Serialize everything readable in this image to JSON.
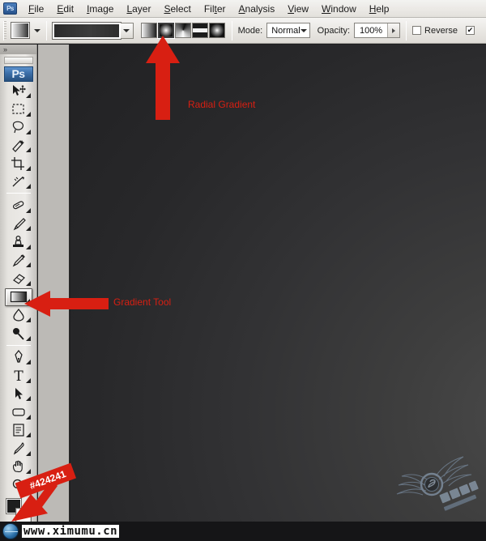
{
  "app": {
    "name": "Adobe Photoshop",
    "logo_text": "Ps"
  },
  "menubar": {
    "items": [
      {
        "label": "File",
        "accel": "F"
      },
      {
        "label": "Edit",
        "accel": "E"
      },
      {
        "label": "Image",
        "accel": "I"
      },
      {
        "label": "Layer",
        "accel": "L"
      },
      {
        "label": "Select",
        "accel": "S"
      },
      {
        "label": "Filter",
        "accel": "t"
      },
      {
        "label": "Analysis",
        "accel": "A"
      },
      {
        "label": "View",
        "accel": "V"
      },
      {
        "label": "Window",
        "accel": "W"
      },
      {
        "label": "Help",
        "accel": "H"
      }
    ]
  },
  "options_bar": {
    "tool_preset_icon": "gradient-preset-icon",
    "gradient_picker_icon": "gradient-preview-swatch",
    "gradient_dropdown_icon": "chevron-down-icon",
    "gradient_types": [
      {
        "name": "linear-gradient",
        "label": "Linear Gradient",
        "selected": false
      },
      {
        "name": "radial-gradient",
        "label": "Radial Gradient",
        "selected": true
      },
      {
        "name": "angle-gradient",
        "label": "Angle Gradient",
        "selected": false
      },
      {
        "name": "reflected-gradient",
        "label": "Reflected Gradient",
        "selected": false
      },
      {
        "name": "diamond-gradient",
        "label": "Diamond Gradient",
        "selected": false
      }
    ],
    "mode_label": "Mode:",
    "mode_value": "Normal",
    "opacity_label": "Opacity:",
    "opacity_value": "100%",
    "reverse_label": "Reverse",
    "reverse_checked": false,
    "dither_checked": true
  },
  "toolbar": {
    "collapse_icon": "double-chevron-right-icon",
    "tools": [
      {
        "name": "move-tool",
        "label": "Move Tool"
      },
      {
        "name": "marquee-tool",
        "label": "Rectangular Marquee Tool"
      },
      {
        "name": "lasso-tool",
        "label": "Lasso Tool"
      },
      {
        "name": "quick-selection-tool",
        "label": "Quick Selection Tool"
      },
      {
        "name": "crop-tool",
        "label": "Crop Tool"
      },
      {
        "name": "slice-tool",
        "label": "Slice Tool"
      },
      {
        "name": "healing-brush-tool",
        "label": "Spot Healing Brush Tool"
      },
      {
        "name": "brush-tool",
        "label": "Brush Tool"
      },
      {
        "name": "clone-stamp-tool",
        "label": "Clone Stamp Tool"
      },
      {
        "name": "history-brush-tool",
        "label": "History Brush Tool"
      },
      {
        "name": "eraser-tool",
        "label": "Eraser Tool"
      },
      {
        "name": "gradient-tool",
        "label": "Gradient Tool"
      },
      {
        "name": "blur-tool",
        "label": "Blur Tool"
      },
      {
        "name": "dodge-tool",
        "label": "Dodge Tool"
      },
      {
        "name": "pen-tool",
        "label": "Pen Tool"
      },
      {
        "name": "type-tool",
        "label": "Horizontal Type Tool"
      },
      {
        "name": "path-selection-tool",
        "label": "Path Selection Tool"
      },
      {
        "name": "shape-tool",
        "label": "Rectangle Tool"
      },
      {
        "name": "notes-tool",
        "label": "Notes Tool"
      },
      {
        "name": "eyedropper-tool",
        "label": "Eyedropper Tool"
      },
      {
        "name": "hand-tool",
        "label": "Hand Tool"
      },
      {
        "name": "zoom-tool",
        "label": "Zoom Tool"
      }
    ],
    "selected_tool": "gradient-tool",
    "foreground_color": "#1e1e1e",
    "background_color": "#ffffff"
  },
  "canvas": {
    "fill_color": "#424241",
    "gradient_type": "radial"
  },
  "annotations": {
    "radial_gradient": "Radial Gradient",
    "gradient_tool": "Gradient Tool",
    "hex_color": "#424241",
    "accent_color": "#d81f12"
  },
  "watermarks": {
    "site": "www.ximumu.cn",
    "logo_name": "winged-badge-logo"
  }
}
